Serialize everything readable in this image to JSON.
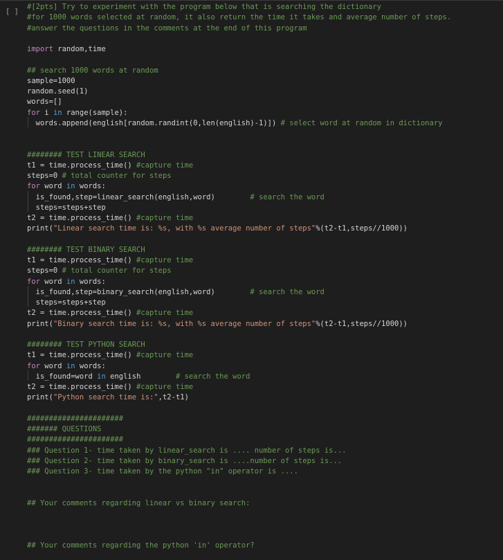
{
  "cell": {
    "gutter": "[ ]"
  },
  "lines": [
    [
      {
        "t": "#[2pts] Try to experiment with the program below that is searching the dictionary",
        "c": "cm"
      }
    ],
    [
      {
        "t": "#for 1000 words selected at random, it also return the time it takes and average number of steps.",
        "c": "cm"
      }
    ],
    [
      {
        "t": "#answer the questions in the comments at the end of this program",
        "c": "cm"
      }
    ],
    [],
    [
      {
        "t": "import",
        "c": "kw"
      },
      {
        "t": " random,time"
      }
    ],
    [],
    [
      {
        "t": "## search 1000 words at random",
        "c": "cm"
      }
    ],
    [
      {
        "t": "sample=1000"
      }
    ],
    [
      {
        "t": "random.seed(1)"
      }
    ],
    [
      {
        "t": "words=[]"
      }
    ],
    [
      {
        "t": "for",
        "c": "kw"
      },
      {
        "t": " i "
      },
      {
        "t": "in",
        "c": "bl"
      },
      {
        "t": " range(sample):"
      }
    ],
    [
      {
        "t": "  words.append(english[random.randint(0,len(english)-1)]) "
      },
      {
        "t": "# select word at random in dictionary",
        "c": "cm"
      }
    ],
    [],
    [],
    [
      {
        "t": "######## TEST LINEAR SEARCH",
        "c": "cm"
      }
    ],
    [
      {
        "t": "t1 = time.process_time() "
      },
      {
        "t": "#capture time",
        "c": "cm"
      }
    ],
    [
      {
        "t": "steps=0 "
      },
      {
        "t": "# total counter for steps",
        "c": "cm"
      }
    ],
    [
      {
        "t": "for",
        "c": "kw"
      },
      {
        "t": " word "
      },
      {
        "t": "in",
        "c": "bl"
      },
      {
        "t": " words:"
      }
    ],
    [
      {
        "t": "  is_found,step=linear_search(english,word)        "
      },
      {
        "t": "# search the word",
        "c": "cm"
      }
    ],
    [
      {
        "t": "  steps=steps+step"
      }
    ],
    [
      {
        "t": "t2 = time.process_time() "
      },
      {
        "t": "#capture time",
        "c": "cm"
      }
    ],
    [
      {
        "t": "print("
      },
      {
        "t": "\"Linear search time is: %s, with %s average number of steps\"",
        "c": "st"
      },
      {
        "t": "%(t2-t1,steps//1000))"
      }
    ],
    [],
    [
      {
        "t": "######## TEST BINARY SEARCH",
        "c": "cm"
      }
    ],
    [
      {
        "t": "t1 = time.process_time() "
      },
      {
        "t": "#capture time",
        "c": "cm"
      }
    ],
    [
      {
        "t": "steps=0 "
      },
      {
        "t": "# total counter for steps",
        "c": "cm"
      }
    ],
    [
      {
        "t": "for",
        "c": "kw"
      },
      {
        "t": " word "
      },
      {
        "t": "in",
        "c": "bl"
      },
      {
        "t": " words:"
      }
    ],
    [
      {
        "t": "  is_found,step=binary_search(english,word)        "
      },
      {
        "t": "# search the word",
        "c": "cm"
      }
    ],
    [
      {
        "t": "  steps=steps+step"
      }
    ],
    [
      {
        "t": "t2 = time.process_time() "
      },
      {
        "t": "#capture time",
        "c": "cm"
      }
    ],
    [
      {
        "t": "print("
      },
      {
        "t": "\"Binary search time is: %s, with %s average number of steps\"",
        "c": "st"
      },
      {
        "t": "%(t2-t1,steps//1000))"
      }
    ],
    [],
    [
      {
        "t": "######## TEST PYTHON SEARCH",
        "c": "cm"
      }
    ],
    [
      {
        "t": "t1 = time.process_time() "
      },
      {
        "t": "#capture time",
        "c": "cm"
      }
    ],
    [
      {
        "t": "for",
        "c": "kw"
      },
      {
        "t": " word "
      },
      {
        "t": "in",
        "c": "bl"
      },
      {
        "t": " words:"
      }
    ],
    [
      {
        "t": "  is_found=word "
      },
      {
        "t": "in",
        "c": "bl"
      },
      {
        "t": " english        "
      },
      {
        "t": "# search the word",
        "c": "cm"
      }
    ],
    [
      {
        "t": "t2 = time.process_time() "
      },
      {
        "t": "#capture time",
        "c": "cm"
      }
    ],
    [
      {
        "t": "print("
      },
      {
        "t": "\"Python search time is:\"",
        "c": "st"
      },
      {
        "t": ",t2-t1)"
      }
    ],
    [],
    [
      {
        "t": "######################",
        "c": "cm"
      }
    ],
    [
      {
        "t": "####### QUESTIONS",
        "c": "cm"
      }
    ],
    [
      {
        "t": "######################",
        "c": "cm"
      }
    ],
    [
      {
        "t": "### Question 1- time taken by linear_search is .... number of steps is...",
        "c": "cm"
      }
    ],
    [
      {
        "t": "### Question 2- time taken by binary_search is ....number of steps is...",
        "c": "cm"
      }
    ],
    [
      {
        "t": "### Question 3- time taken by the python \"in\" operator is ....",
        "c": "cm"
      }
    ],
    [],
    [],
    [
      {
        "t": "## Your comments regarding linear vs binary search:",
        "c": "cm"
      }
    ],
    [],
    [],
    [],
    [
      {
        "t": "## Your comments regarding the python 'in' operator?",
        "c": "cm"
      }
    ]
  ]
}
